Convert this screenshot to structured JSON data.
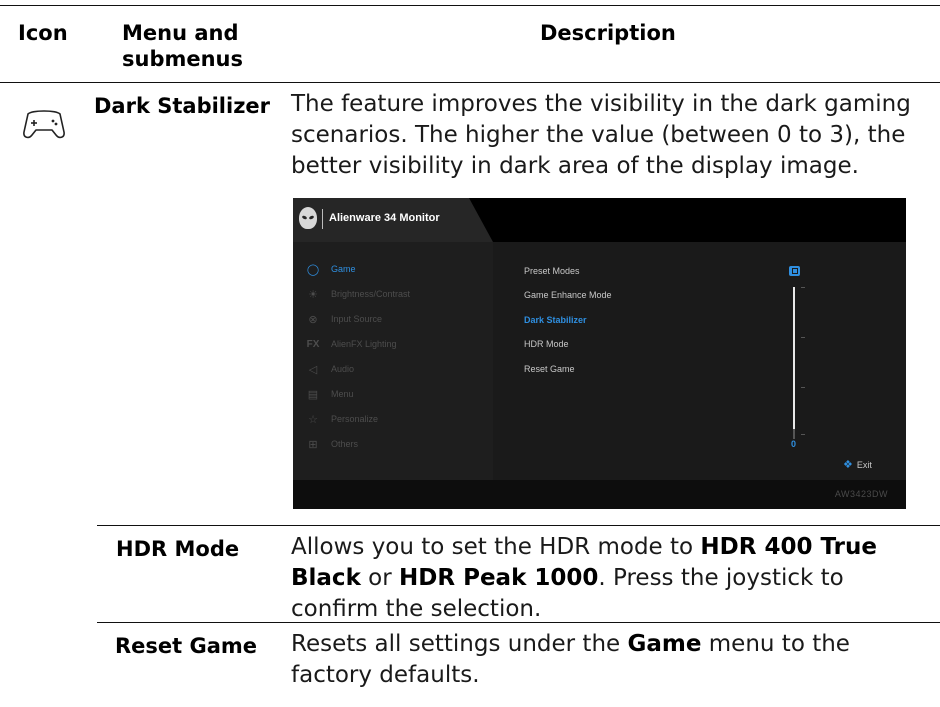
{
  "table": {
    "headers": {
      "icon": "Icon",
      "menu": "Menu and submenus",
      "description": "Description"
    }
  },
  "rows": {
    "dark_stabilizer": {
      "icon": "gamepad-icon",
      "term": "Dark Stabilizer",
      "description": "The feature improves the visibility in the dark gaming scenarios. The higher the value (between 0 to 3), the better visibility in dark area of the display image."
    },
    "hdr_mode": {
      "term": "HDR Mode",
      "desc_1": "Allows you to set the HDR mode to ",
      "desc_b1": "HDR 400 True Black",
      "desc_2": " or ",
      "desc_b2": "HDR Peak 1000",
      "desc_3": ". Press the joystick to confirm the selection."
    },
    "reset_game": {
      "term": "Reset Game",
      "desc_1": "Resets all settings under the ",
      "desc_b1": "Game",
      "desc_2": " menu to the factory defaults."
    }
  },
  "osd": {
    "title": "Alienware 34 Monitor",
    "model": "AW3423DW",
    "menu": [
      {
        "label": "Game",
        "icon": "gamepad-icon"
      },
      {
        "label": "Brightness/Contrast",
        "icon": "sun-icon"
      },
      {
        "label": "Input Source",
        "icon": "input-icon"
      },
      {
        "label": "AlienFX Lighting",
        "icon": "fx-icon"
      },
      {
        "label": "Audio",
        "icon": "speaker-icon"
      },
      {
        "label": "Menu",
        "icon": "menu-icon"
      },
      {
        "label": "Personalize",
        "icon": "star-icon"
      },
      {
        "label": "Others",
        "icon": "others-icon"
      }
    ],
    "submenu": [
      "Preset Modes",
      "Game Enhance Mode",
      "Dark Stabilizer",
      "HDR Mode",
      "Reset Game"
    ],
    "active_menu": "Game",
    "active_submenu": "Dark Stabilizer",
    "slider_value": "0",
    "exit_label": "Exit",
    "accent_color": "#2f8fe0"
  }
}
